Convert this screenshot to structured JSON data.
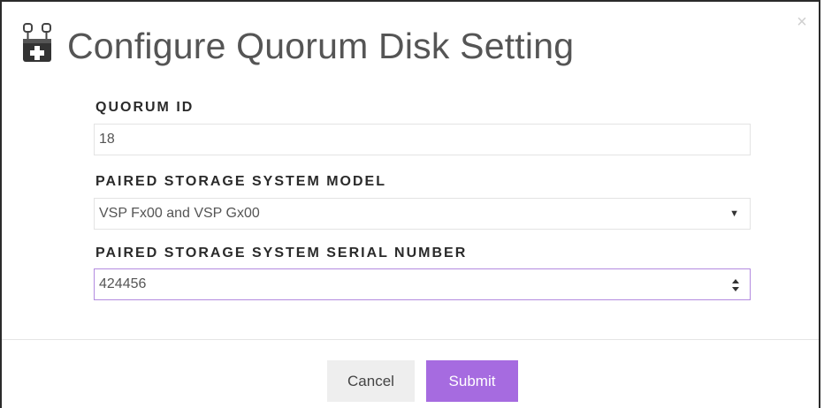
{
  "dialog": {
    "title": "Configure Quorum Disk Setting",
    "icon": "storage-node-icon",
    "close_icon": "close-icon"
  },
  "form": {
    "quorum_id": {
      "label": "QUORUM ID",
      "value": "18"
    },
    "model": {
      "label": "PAIRED STORAGE SYSTEM MODEL",
      "value": "VSP Fx00 and VSP Gx00"
    },
    "serial": {
      "label": "PAIRED STORAGE SYSTEM SERIAL NUMBER",
      "value": "424456"
    }
  },
  "footer": {
    "cancel_label": "Cancel",
    "submit_label": "Submit"
  },
  "colors": {
    "accent": "#a66be0",
    "focus_border": "#b38be0",
    "title_text": "#555555"
  }
}
